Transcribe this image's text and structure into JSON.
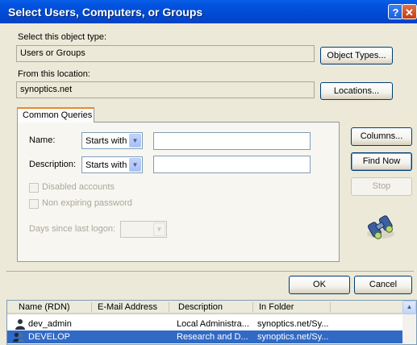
{
  "window": {
    "title": "Select Users, Computers, or Groups",
    "help_glyph": "?",
    "close_glyph": "✕"
  },
  "object_type": {
    "label": "Select this object type:",
    "value": "Users or Groups",
    "button": "Object Types..."
  },
  "location": {
    "label": "From this location:",
    "value": "synoptics.net",
    "button": "Locations..."
  },
  "queries": {
    "tab": "Common Queries",
    "name_label": "Name:",
    "name_op": "Starts with",
    "description_label": "Description:",
    "description_op": "Starts with",
    "disabled_accounts": "Disabled accounts",
    "non_expiring": "Non expiring password",
    "days_label": "Days since last logon:"
  },
  "side_buttons": {
    "columns": "Columns...",
    "find_now": "Find Now",
    "stop": "Stop"
  },
  "dialog_buttons": {
    "ok": "OK",
    "cancel": "Cancel"
  },
  "results": {
    "columns": [
      "Name (RDN)",
      "E-Mail Address",
      "Description",
      "In Folder"
    ],
    "rows": [
      {
        "name": "dev_admin",
        "email": "",
        "description": "Local Administra...",
        "folder": "synoptics.net/Sy..."
      },
      {
        "name": "DEVELOP",
        "email": "",
        "description": "Research and D...",
        "folder": "synoptics.net/Sy..."
      }
    ],
    "selected_row": 1
  },
  "icons": {
    "search": "binoculars-search-icon",
    "user": "user-icon",
    "group": "group-icon"
  }
}
